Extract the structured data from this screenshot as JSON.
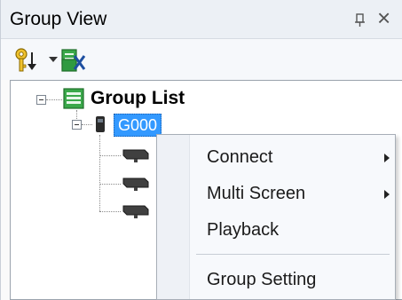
{
  "panel": {
    "title": "Group View",
    "pin_glyph": "pin-icon",
    "close_glyph": "×"
  },
  "toolbar": {
    "buttons": [
      {
        "icon": "key-sort-icon",
        "has_dropdown": true
      },
      {
        "icon": "group-export-icon",
        "has_dropdown": false
      }
    ]
  },
  "tree": {
    "root": {
      "label": "Group List",
      "icon": "group-list-icon",
      "expanded": true
    },
    "group": {
      "label": "G000",
      "icon": "device-group-icon",
      "selected": true,
      "expanded": true
    },
    "cameras": [
      {
        "icon": "camera-icon"
      },
      {
        "icon": "camera-icon"
      },
      {
        "icon": "camera-icon"
      }
    ]
  },
  "context_menu": {
    "items": [
      {
        "label": "Connect",
        "submenu": true
      },
      {
        "label": "Multi Screen",
        "submenu": true
      },
      {
        "label": "Playback",
        "submenu": false
      },
      {
        "label": "Group Setting",
        "submenu": false
      }
    ]
  },
  "colors": {
    "selection": "#3399ff",
    "title_bar": "#ecf0f5",
    "menu_bg": "#f7f9fc"
  }
}
